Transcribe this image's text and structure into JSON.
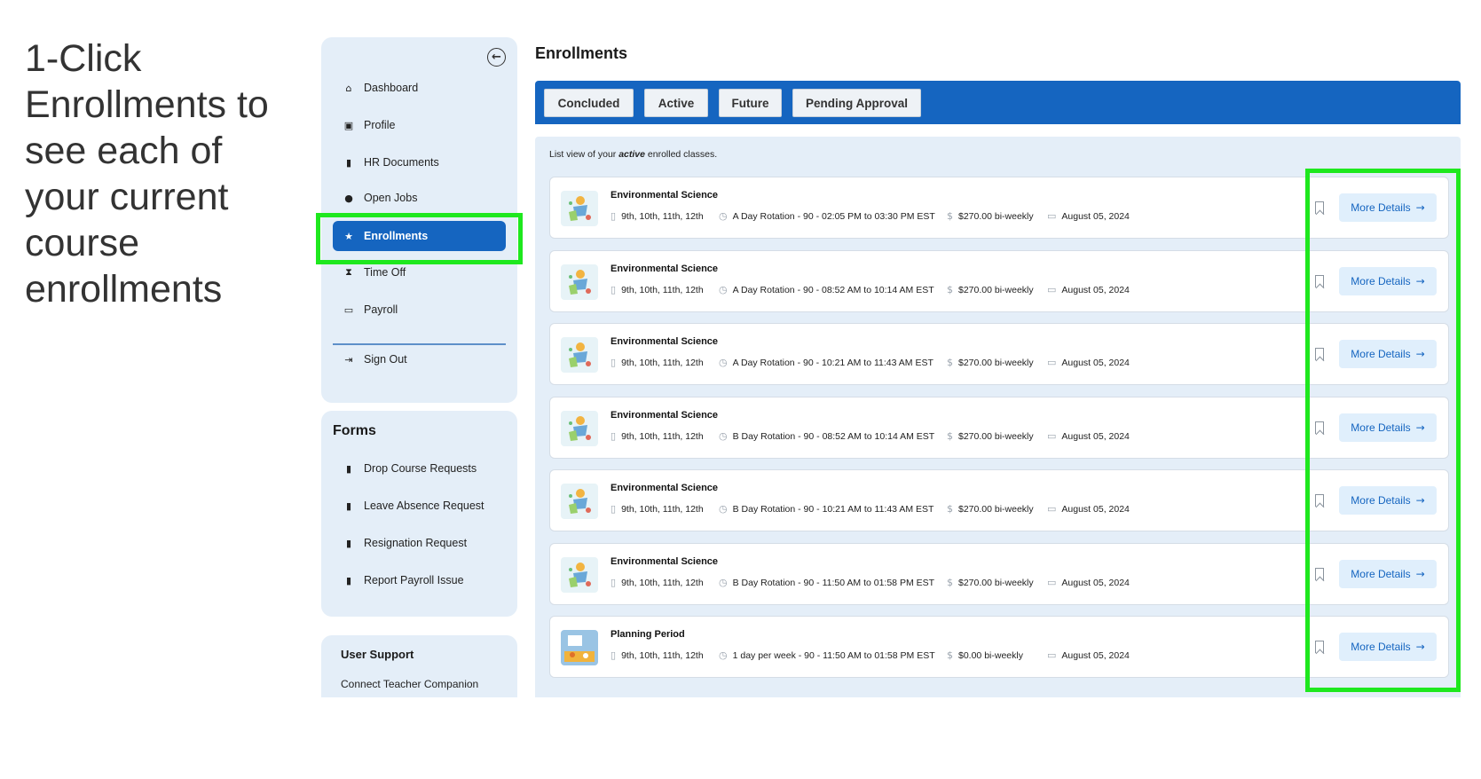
{
  "instruction": "1-Click Enrollments to see each of your current course enrollments",
  "sidebar": {
    "collapse_icon": "arrow-left-circle-icon",
    "items": [
      {
        "label": "Dashboard",
        "icon": "home-icon",
        "glyph": "⌂"
      },
      {
        "label": "Profile",
        "icon": "id-card-icon",
        "glyph": "▣"
      },
      {
        "label": "HR Documents",
        "icon": "file-icon",
        "glyph": "▮"
      },
      {
        "label": "Open Jobs",
        "icon": "briefcase-icon",
        "glyph": "●"
      },
      {
        "label": "Enrollments",
        "icon": "star-icon",
        "glyph": "★",
        "active": true
      },
      {
        "label": "Time Off",
        "icon": "binoculars-icon",
        "glyph": "⧗"
      },
      {
        "label": "Payroll",
        "icon": "credit-card-icon",
        "glyph": "▭"
      }
    ],
    "sign_out": {
      "label": "Sign Out",
      "icon": "sign-out-icon",
      "glyph": "⇥"
    }
  },
  "forms": {
    "title": "Forms",
    "items": [
      {
        "label": "Drop Course Requests",
        "icon": "file-icon",
        "glyph": "▮"
      },
      {
        "label": "Leave Absence Request",
        "icon": "file-icon",
        "glyph": "▮"
      },
      {
        "label": "Resignation Request",
        "icon": "file-icon",
        "glyph": "▮"
      },
      {
        "label": "Report Payroll Issue",
        "icon": "file-icon",
        "glyph": "▮"
      }
    ]
  },
  "support": {
    "title": "User Support",
    "link": "Connect Teacher Companion"
  },
  "main": {
    "title": "Enrollments",
    "tabs": [
      "Concluded",
      "Active",
      "Future",
      "Pending Approval"
    ],
    "caption_pre": "List view of your ",
    "caption_bold": "active",
    "caption_post": " enrolled classes.",
    "more_label": "More Details",
    "rows": [
      {
        "title": "Environmental Science",
        "grades": "9th, 10th, 11th, 12th",
        "schedule": "A Day Rotation - 90 - 02:05 PM to 03:30 PM EST",
        "price": "$270.00 bi-weekly",
        "date": "August 05, 2024",
        "thumb": "science"
      },
      {
        "title": "Environmental Science",
        "grades": "9th, 10th, 11th, 12th",
        "schedule": "A Day Rotation - 90 - 08:52 AM to 10:14 AM EST",
        "price": "$270.00 bi-weekly",
        "date": "August 05, 2024",
        "thumb": "science"
      },
      {
        "title": "Environmental Science",
        "grades": "9th, 10th, 11th, 12th",
        "schedule": "A Day Rotation - 90 - 10:21 AM to 11:43 AM EST",
        "price": "$270.00 bi-weekly",
        "date": "August 05, 2024",
        "thumb": "science"
      },
      {
        "title": "Environmental Science",
        "grades": "9th, 10th, 11th, 12th",
        "schedule": "B Day Rotation - 90 - 08:52 AM to 10:14 AM EST",
        "price": "$270.00 bi-weekly",
        "date": "August 05, 2024",
        "thumb": "science"
      },
      {
        "title": "Environmental Science",
        "grades": "9th, 10th, 11th, 12th",
        "schedule": "B Day Rotation - 90 - 10:21 AM to 11:43 AM EST",
        "price": "$270.00 bi-weekly",
        "date": "August 05, 2024",
        "thumb": "science"
      },
      {
        "title": "Environmental Science",
        "grades": "9th, 10th, 11th, 12th",
        "schedule": "B Day Rotation - 90 - 11:50 AM to 01:58 PM EST",
        "price": "$270.00 bi-weekly",
        "date": "August 05, 2024",
        "thumb": "science"
      },
      {
        "title": "Planning Period",
        "grades": "9th, 10th, 11th, 12th",
        "schedule": "1 day per week - 90 - 11:50 AM to 01:58 PM EST",
        "price": "$0.00 bi-weekly",
        "date": "August 05, 2024",
        "thumb": "planning"
      }
    ]
  },
  "colors": {
    "accent": "#1565c0",
    "highlight": "#1ee81e",
    "panel": "#e4eef8"
  }
}
